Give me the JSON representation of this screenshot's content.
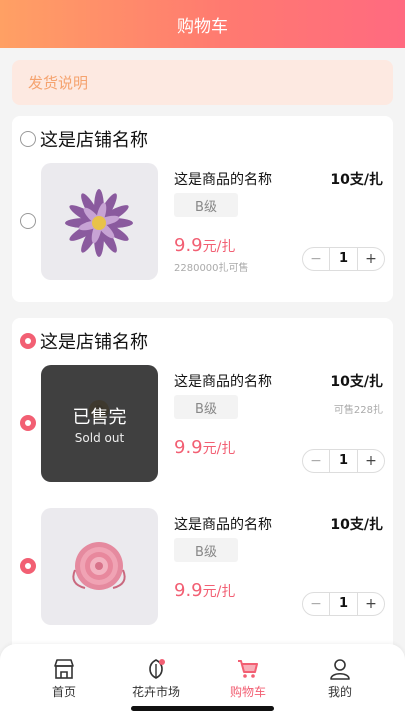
{
  "header": {
    "title": "购物车"
  },
  "notice": {
    "label": "发货说明"
  },
  "shops": [
    {
      "name": "这是店铺名称",
      "selected": false,
      "items": [
        {
          "name": "这是商品的名称",
          "unit": "10支/扎",
          "grade": "B级",
          "price": "9.9",
          "price_unit": "元/扎",
          "stock": "2280000扎可售",
          "qty": "1",
          "selected": false,
          "sold_out": false,
          "flower": "purple-chrysanthemum"
        }
      ]
    },
    {
      "name": "这是店铺名称",
      "selected": true,
      "items": [
        {
          "name": "这是商品的名称",
          "unit": "10支/扎",
          "grade": "B级",
          "price": "9.9",
          "price_unit": "元/扎",
          "stock": "可售228扎",
          "qty": "1",
          "selected": true,
          "sold_out": true,
          "sold_out_label": "已售完",
          "sold_out_sub": "Sold out",
          "flower": "yellow-flower"
        },
        {
          "name": "这是商品的名称",
          "unit": "10支/扎",
          "grade": "B级",
          "price": "9.9",
          "price_unit": "元/扎",
          "qty": "1",
          "selected": true,
          "sold_out": false,
          "flower": "pink-rose"
        }
      ]
    }
  ],
  "stepper": {
    "minus": "−",
    "plus": "+"
  },
  "tabbar": [
    {
      "label": "首页",
      "icon": "shop-icon",
      "active": false
    },
    {
      "label": "花卉市场",
      "icon": "leaf-icon",
      "active": false
    },
    {
      "label": "购物车",
      "icon": "cart-icon",
      "active": true
    },
    {
      "label": "我的",
      "icon": "user-icon",
      "active": false
    }
  ],
  "colors": {
    "accent": "#f25f73",
    "header_start": "#ffa064",
    "header_end": "#ff6a80",
    "notice_bg": "#fde9e1",
    "notice_text": "#f5a36f"
  }
}
